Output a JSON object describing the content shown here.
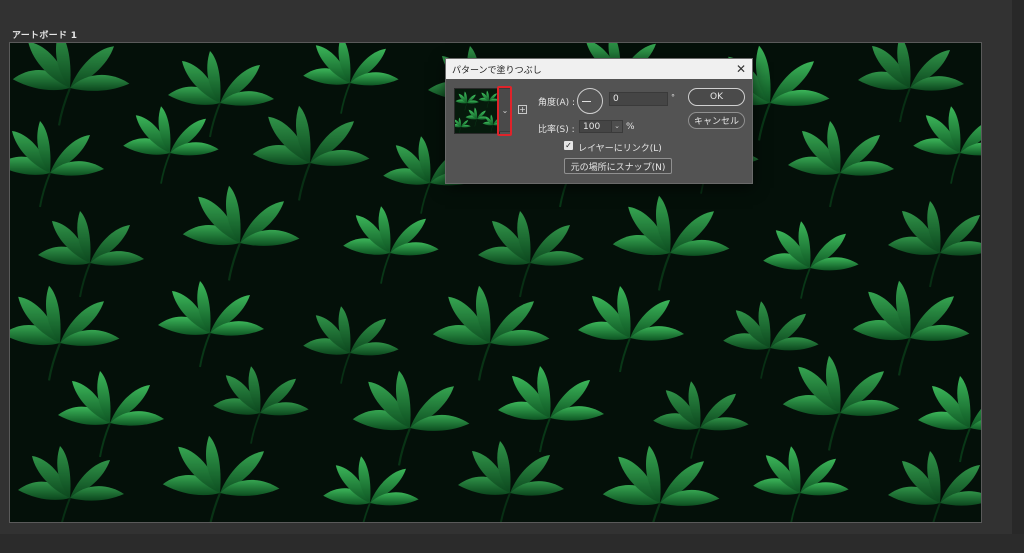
{
  "canvas": {
    "artboard_label": "アートボード 1"
  },
  "dialog": {
    "title": "パターンで塗りつぶし",
    "close_icon": "close-icon",
    "angle_label": "角度(A) :",
    "angle_value": "0",
    "angle_unit": "°",
    "scale_label": "比率(S) :",
    "scale_value": "100",
    "scale_unit": "%",
    "link_layer_label": "レイヤーにリンク(L)",
    "link_layer_checked": true,
    "snap_button": "元の場所にスナップ(N)",
    "ok_button": "OK",
    "cancel_button": "キャンセル"
  },
  "colors": {
    "highlight": "#e0232a",
    "leaf": "#2a9a4a",
    "background": "#041009"
  }
}
